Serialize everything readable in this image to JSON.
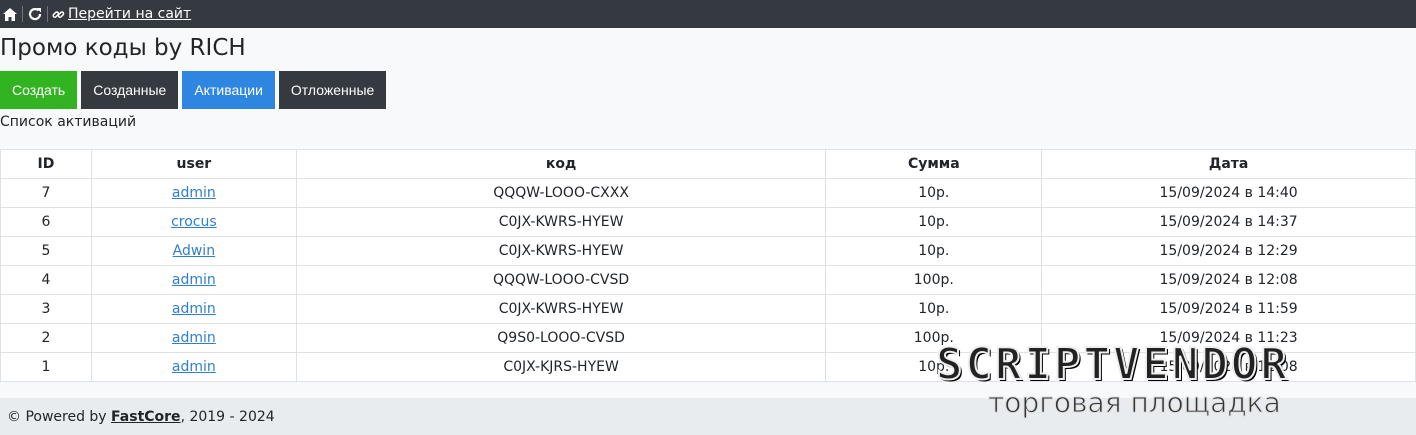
{
  "topbar": {
    "home_icon": "home-icon",
    "refresh_icon": "refresh-icon",
    "link_icon": "link-icon",
    "site_link": "Перейти на сайт"
  },
  "page": {
    "title": "Промо коды by RICH",
    "subtitle": "Список активаций"
  },
  "tabs": [
    {
      "label": "Создать",
      "color": "#32b422"
    },
    {
      "label": "Созданные",
      "color": "#343a40"
    },
    {
      "label": "Активации",
      "color": "#2f86e0"
    },
    {
      "label": "Отложенные",
      "color": "#343a40"
    }
  ],
  "table": {
    "headers": [
      "ID",
      "user",
      "код",
      "Сумма",
      "Дата"
    ],
    "rows": [
      {
        "id": "7",
        "user": "admin",
        "code": "QQQW-LOOO-CXXX",
        "sum": "10р.",
        "date": "15/09/2024 в 14:40"
      },
      {
        "id": "6",
        "user": "crocus",
        "code": "C0JX-KWRS-HYEW",
        "sum": "10р.",
        "date": "15/09/2024 в 14:37"
      },
      {
        "id": "5",
        "user": "Adwin",
        "code": "C0JX-KWRS-HYEW",
        "sum": "10р.",
        "date": "15/09/2024 в 12:29"
      },
      {
        "id": "4",
        "user": "admin",
        "code": "QQQW-LOOO-CVSD",
        "sum": "100р.",
        "date": "15/09/2024 в 12:08"
      },
      {
        "id": "3",
        "user": "admin",
        "code": "C0JX-KWRS-HYEW",
        "sum": "10р.",
        "date": "15/09/2024 в 11:59"
      },
      {
        "id": "2",
        "user": "admin",
        "code": "Q9S0-LOOO-CVSD",
        "sum": "100р.",
        "date": "15/09/2024 в 11:23"
      },
      {
        "id": "1",
        "user": "admin",
        "code": "C0JX-KJRS-HYEW",
        "sum": "10р.",
        "date": "15/09/2024 в 11:08"
      }
    ]
  },
  "footer": {
    "prefix": "© Powered by",
    "brand": "FastCore",
    "suffix": ", 2019 - 2024"
  },
  "watermark": {
    "top": "SCRIPTVENDOR",
    "bottom": "торговая площадка"
  }
}
